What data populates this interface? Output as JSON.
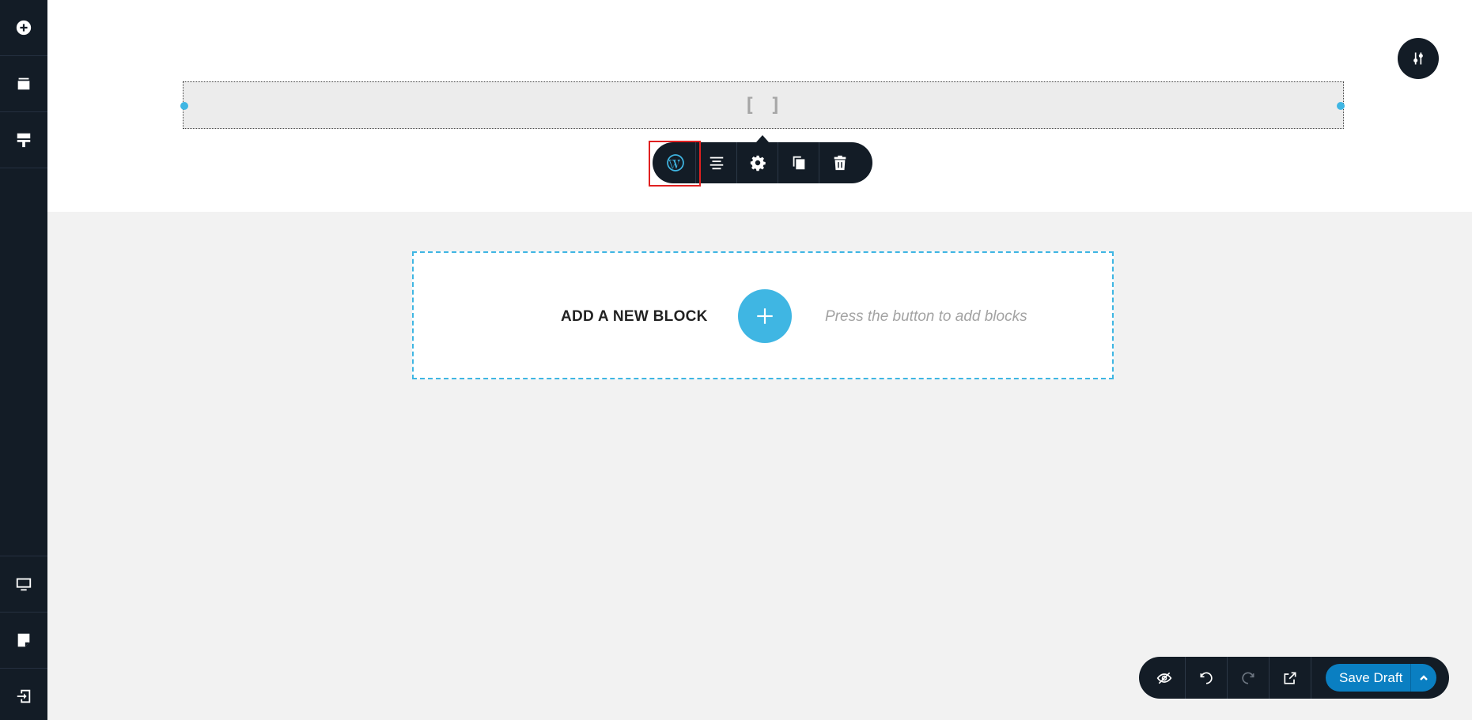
{
  "block": {
    "shortcode_glyph": "[ ]"
  },
  "add_block": {
    "title": "ADD A NEW BLOCK",
    "hint": "Press the button to add blocks"
  },
  "action_bar": {
    "save_label": "Save Draft"
  },
  "sidebar": {
    "top_icons": [
      "plus-circle-icon",
      "layers-icon",
      "paint-roller-icon"
    ],
    "bottom_icons": [
      "desktop-icon",
      "page-edit-icon",
      "exit-icon"
    ]
  },
  "toolbar_icons": [
    "wordpress-icon",
    "align-center-icon",
    "gear-icon",
    "duplicate-icon",
    "trash-icon"
  ],
  "colors": {
    "dark": "#131c26",
    "accent": "#3fb6e3",
    "save": "#0a7fc2",
    "highlight": "#e02020"
  }
}
